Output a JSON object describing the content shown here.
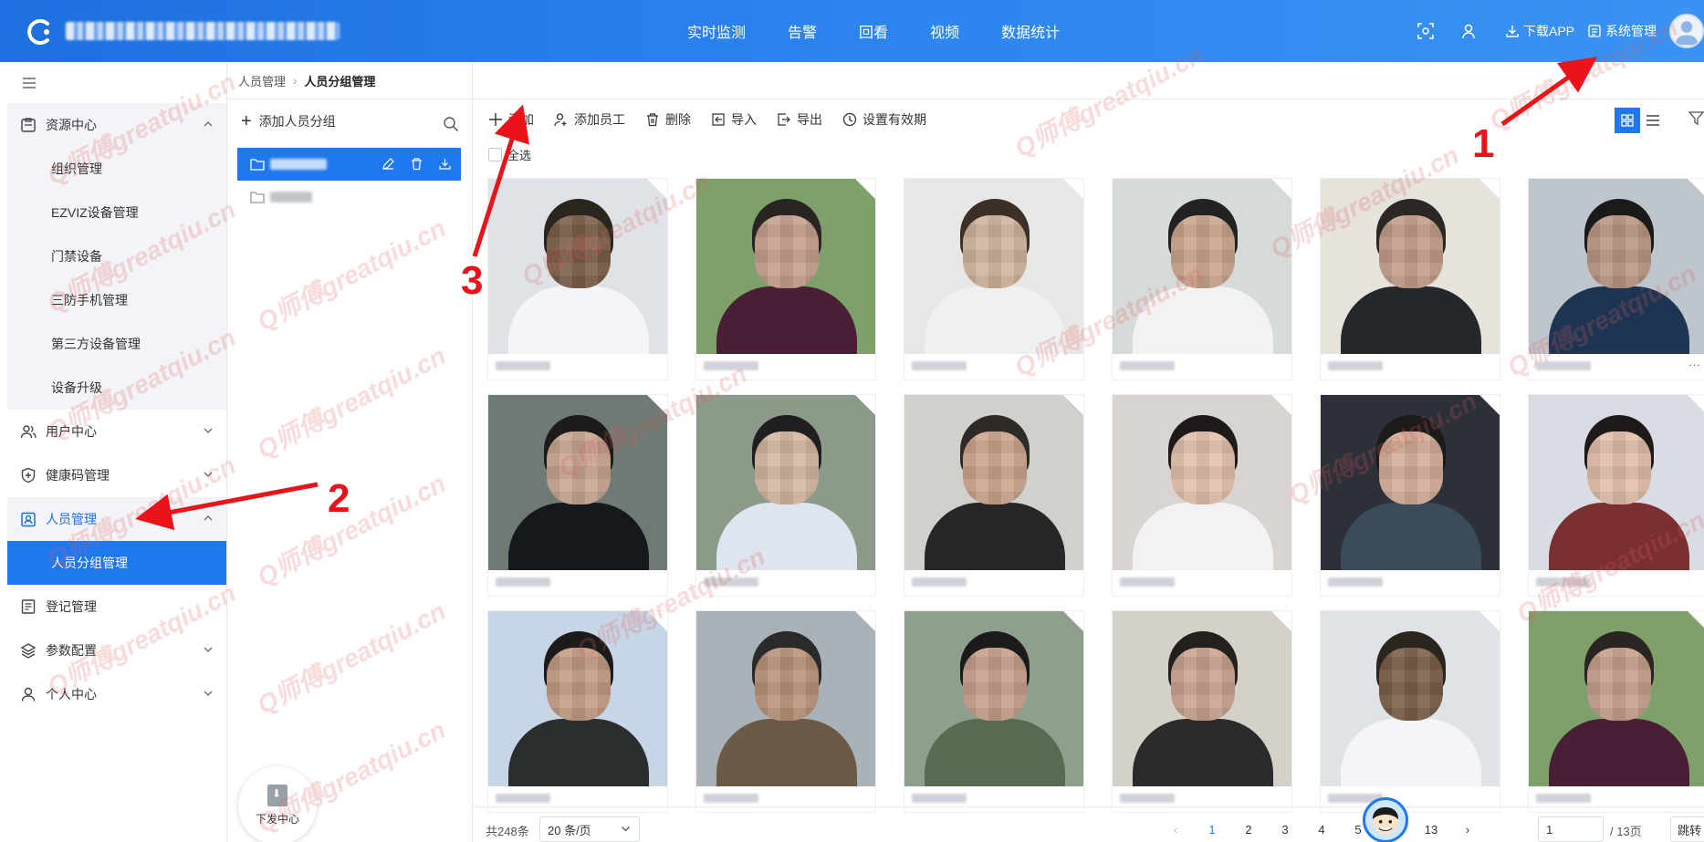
{
  "header": {
    "nav": [
      "实时监测",
      "告警",
      "回看",
      "视频",
      "数据统计"
    ],
    "download_app": "下载APP",
    "system_admin": "系统管理"
  },
  "sidebar": {
    "groups": [
      {
        "label": "资源中心",
        "icon": "clipboard-icon",
        "expanded": true,
        "items": [
          "组织管理",
          "EZVIZ设备管理",
          "门禁设备",
          "三防手机管理",
          "第三方设备管理",
          "设备升级"
        ]
      },
      {
        "label": "用户中心",
        "icon": "users-icon"
      },
      {
        "label": "健康码管理",
        "icon": "shield-plus-icon"
      },
      {
        "label": "人员管理",
        "icon": "id-badge-icon",
        "expanded": true,
        "active": true,
        "items": [
          "人员分组管理"
        ]
      },
      {
        "label": "登记管理",
        "icon": "register-icon"
      },
      {
        "label": "参数配置",
        "icon": "layers-icon"
      },
      {
        "label": "个人中心",
        "icon": "user-icon"
      }
    ]
  },
  "breadcrumb": {
    "parent": "人员管理",
    "current": "人员分组管理"
  },
  "group_panel": {
    "add_group": "添加人员分组",
    "download_center": "下发中心"
  },
  "toolbar": {
    "add": "添加",
    "add_employee": "添加员工",
    "delete": "删除",
    "import": "导入",
    "export": "导出",
    "set_validity": "设置有效期"
  },
  "select_all": "全选",
  "pagination": {
    "total": "共248条",
    "page_size": "20 条/页",
    "pages": [
      "1",
      "2",
      "3",
      "4",
      "5",
      "...",
      "13"
    ],
    "current": "1",
    "jump_value": "1",
    "total_pages": "/ 13页",
    "jump": "跳转"
  },
  "annotations": [
    "1",
    "2",
    "3"
  ],
  "watermark": "Q师傅greatqiu.cn",
  "colors": {
    "primary": "#1f78ee",
    "header_gradient_start": "#1f6fe0",
    "annotation_red": "#e8141a"
  }
}
